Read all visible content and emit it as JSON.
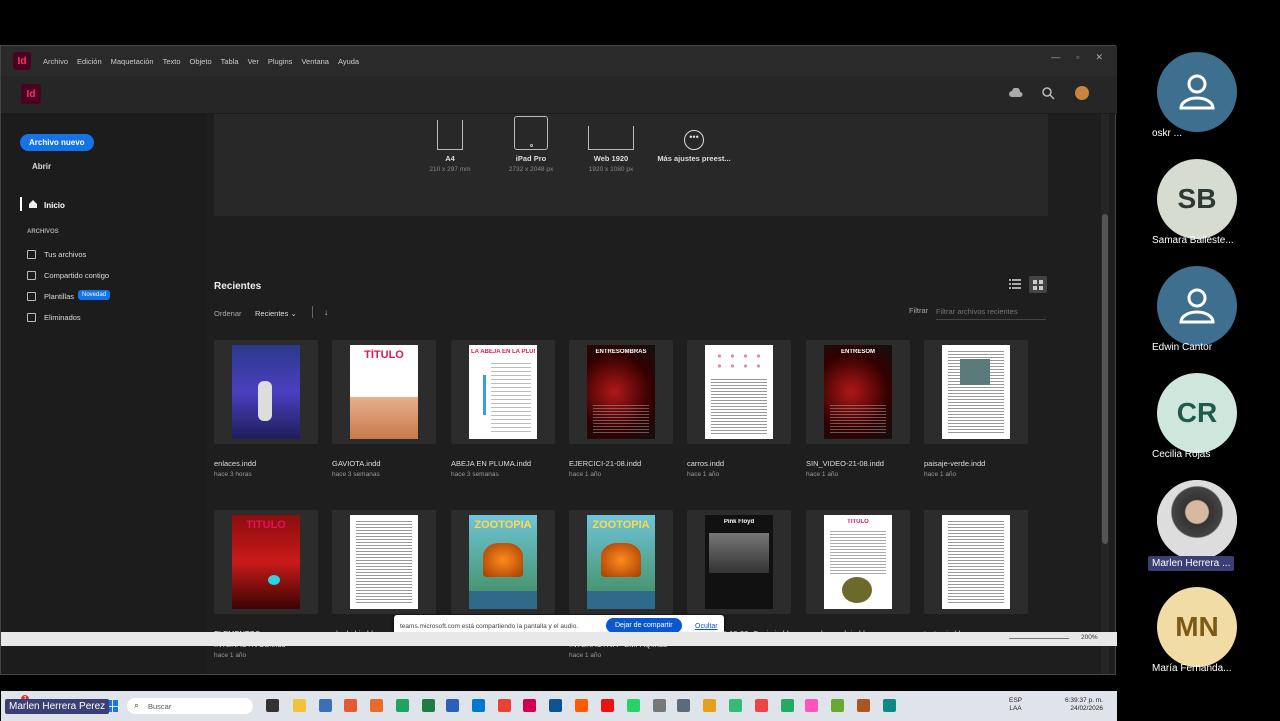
{
  "app": {
    "logo": "Id",
    "menu": [
      "Archivo",
      "Edición",
      "Maquetación",
      "Texto",
      "Objeto",
      "Tabla",
      "Ver",
      "Plugins",
      "Ventana",
      "Ayuda"
    ],
    "window_controls": [
      "—",
      "▫",
      "✕"
    ]
  },
  "sidebar": {
    "new_button": "Archivo nuevo",
    "open": "Abrir",
    "home": "Inicio",
    "section": "ARCHIVOS",
    "items": [
      {
        "label": "Tus archivos",
        "icon": "file-icon"
      },
      {
        "label": "Compartido contigo",
        "icon": "user-icon"
      },
      {
        "label": "Plantillas",
        "icon": "template-icon",
        "badge": "Novedad"
      },
      {
        "label": "Eliminados",
        "icon": "trash-icon"
      }
    ]
  },
  "presets": [
    {
      "label": "A4",
      "sub": "210 x 297 mm"
    },
    {
      "label": "iPad Pro",
      "sub": "2732 x 2048 px"
    },
    {
      "label": "Web 1920",
      "sub": "1920 x 1080 px"
    },
    {
      "label": "Más ajustes preest...",
      "sub": ""
    }
  ],
  "recent": {
    "title": "Recientes",
    "sort_label": "Ordenar",
    "sort_value": "Recientes",
    "filter_label": "Filtrar",
    "filter_placeholder": "Filtrar archivos recientes"
  },
  "files": [
    {
      "name": "enlaces.indd",
      "time": "hace 3 horas",
      "style": "blue",
      "title": ""
    },
    {
      "name": "GAVIOTA.indd",
      "time": "hace 3 semanas",
      "style": "titulo",
      "title": "TÍTULO"
    },
    {
      "name": "ABEJA EN PLUMA.indd",
      "time": "hace 3 semanas",
      "style": "abeja",
      "title": "LA ABEJA EN LA PLUMA"
    },
    {
      "name": "EJERCICI-21-08.indd",
      "time": "hace 1 año",
      "style": "dark",
      "title": "ENTRESOMBRAS"
    },
    {
      "name": "carros.indd",
      "time": "hace 1 año",
      "style": "carros",
      "title": ""
    },
    {
      "name": "SIN_VIDEO-21-08.indd",
      "time": "hace 1 año",
      "style": "dark",
      "title": "ENTRESOM"
    },
    {
      "name": "paisaje-verde.indd",
      "time": "hace 1 año",
      "style": "text",
      "title": ""
    },
    {
      "name": "ELEMENTOS-INTERACTIVOS.indd",
      "time": "hace 1 año",
      "style": "red",
      "title": "TITULO"
    },
    {
      "name": "el arbol.indd",
      "time": "hace 1 año",
      "style": "plain",
      "title": ""
    },
    {
      "name": "ZOOTOPIa.indd",
      "time": "hace 1 año",
      "style": "zoo",
      "title": "ZOOTOPIA"
    },
    {
      "name": "REVISTA ZOOTOPIA INTERACTIVA - EMPAQ.indd",
      "time": "hace 1 año",
      "style": "zoo",
      "title": "ZOOTOPIA"
    },
    {
      "name": "EJERCICIO 18-08- Copia.indd",
      "time": "hace 1 año",
      "style": "floyd",
      "title": "Pink Floyd"
    },
    {
      "name": "prueba-epub.indd",
      "time": "hace 1 año",
      "style": "epub",
      "title": "TÍTULO"
    },
    {
      "name": "textos.indd",
      "time": "hace 1 año",
      "style": "plain",
      "title": ""
    }
  ],
  "share_bar": {
    "text": "teams.microsoft.com está compartiendo la pantalla y el audio.",
    "stop": "Dejar de compartir",
    "hide": "Ocultar"
  },
  "statusbar": {
    "zoom": "200%"
  },
  "taskbar": {
    "search": "Buscar",
    "lang": "ESP",
    "lang2": "LAA",
    "time": "6:39:37 p. m.",
    "date": "24/02/2026",
    "notif": "2"
  },
  "participants": [
    {
      "name": "oskr ...",
      "initials": "",
      "bg": "#3e6f8e",
      "fg": "#ffffff"
    },
    {
      "name": "Samara Balleste...",
      "initials": "SB",
      "bg": "#d6dcd0",
      "fg": "#2d3a32"
    },
    {
      "name": "Edwin Cantor",
      "initials": "",
      "bg": "#3e6f8e",
      "fg": "#ffffff"
    },
    {
      "name": "Cecilia Rojas",
      "initials": "CR",
      "bg": "#cfe6dc",
      "fg": "#1f5a4a"
    },
    {
      "name": "Marlen Herrera ...",
      "initials": "",
      "bg": "#e9e9e9",
      "fg": "#333"
    },
    {
      "name": "María Fernanda...",
      "initials": "MN",
      "bg": "#f2dca6",
      "fg": "#7a5a14"
    }
  ],
  "presenter": "Marlen Herrera Perez",
  "colors": {
    "accent": "#1473e6",
    "indesign": "#49021f"
  }
}
